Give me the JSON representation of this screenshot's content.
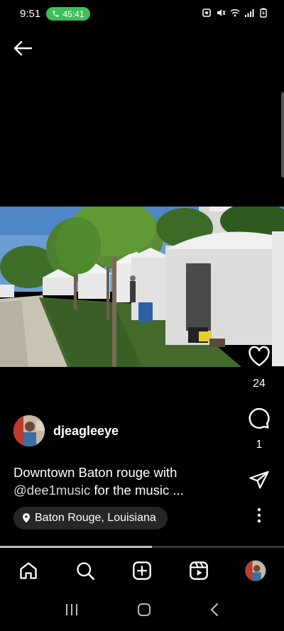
{
  "status_bar": {
    "time": "9:51",
    "call_timer": "45:41",
    "call_color": "#3fbf5a"
  },
  "post": {
    "username": "djeagleeye",
    "caption_text": "Downtown Baton rouge with",
    "caption_mention": "@dee1music",
    "caption_tail": " for the music ...",
    "location": "Baton Rouge, Louisiana",
    "progress_fraction": 0.535
  },
  "actions": {
    "like_count": "24",
    "comment_count": "1",
    "like_icon": "heart-icon",
    "comment_icon": "comment-icon",
    "share_icon": "send-icon",
    "more_icon": "more-vertical-icon"
  },
  "bottom_nav": {
    "items": [
      "home-icon",
      "search-icon",
      "create-icon",
      "reels-icon",
      "profile-avatar"
    ]
  },
  "system_nav": {
    "items": [
      "recent-apps-icon",
      "home-button-icon",
      "back-nav-icon"
    ]
  }
}
